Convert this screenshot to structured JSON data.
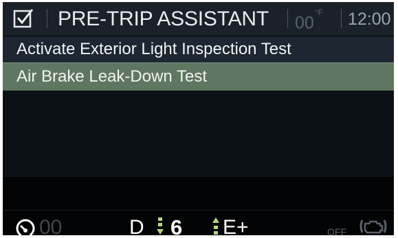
{
  "header": {
    "title": "PRE-TRIP ASSISTANT",
    "temperature": "00",
    "temperature_unit": "°F",
    "time": "12:00",
    "check_icon": "checkbox-checked-icon"
  },
  "menu": {
    "items": [
      {
        "label": "Activate Exterior Light Inspection Test",
        "selected": false
      },
      {
        "label": "Air Brake Leak-Down Test",
        "selected": true
      }
    ]
  },
  "status": {
    "speed_icon": "speedometer-icon",
    "speed": "00",
    "gear_mode": "D",
    "gear_number": "6",
    "drive_mode": "E+",
    "engine_status": "OFF",
    "engine_icon": "engine-icon",
    "arrow_color": "#b7d77c"
  },
  "colors": {
    "header_bg": "#1b2128",
    "selected_bg": "#5f7760",
    "item_bg": "#1d2631"
  }
}
